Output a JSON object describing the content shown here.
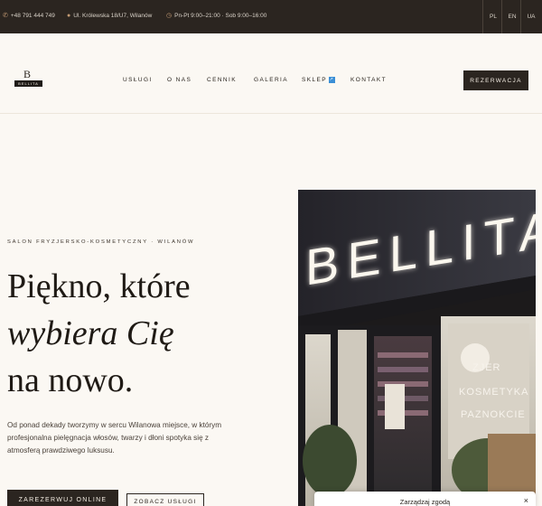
{
  "topbar": {
    "phone": "+48 791 444 749",
    "address": "Ul. Królewska 18/U7, Wilanów",
    "hours": "Pn-Pt 9:00–21:00 · Sob 9:00–16:00",
    "languages": [
      "PL",
      "EN",
      "UA"
    ],
    "icons": {
      "phone": "phone-icon",
      "address": "pin-icon",
      "hours": "clock-icon"
    }
  },
  "header": {
    "logo_letter": "B",
    "logo_text": "BELLITA",
    "nav": [
      "USŁUGI",
      "O NAS",
      "CENNIK",
      "GALERIA",
      "SKLEP",
      "KONTAKT"
    ],
    "reserve": "REZERWACJA"
  },
  "hero": {
    "eyebrow": "SALON FRYZJERSKO-KOSMETYCZNY · WILANÓW",
    "heading_line1": "Piękno, które",
    "heading_line2": "wybiera Cię",
    "heading_line3": "na nowo.",
    "lead": "Od ponad dekady tworzymy w sercu Wilanowa miejsce, w którym profesjonalna pielęgnacja włosów, twarzy i dłoni spotyka się z atmosferą prawdziwego luksusu.",
    "cta_primary": "ZAREZERWUJ ONLINE",
    "cta_secondary": "ZOBACZ USŁUGI"
  },
  "photo": {
    "sign": "BELLITA",
    "window_lines": [
      "ZJER",
      "KOSMETYKA",
      "PAZNOKCIE"
    ]
  },
  "cookie": {
    "title": "Zarządzaj zgodą",
    "close": "×"
  },
  "colors": {
    "dark": "#2b2520",
    "background": "#fbf8f3",
    "accent": "#c29a73"
  }
}
